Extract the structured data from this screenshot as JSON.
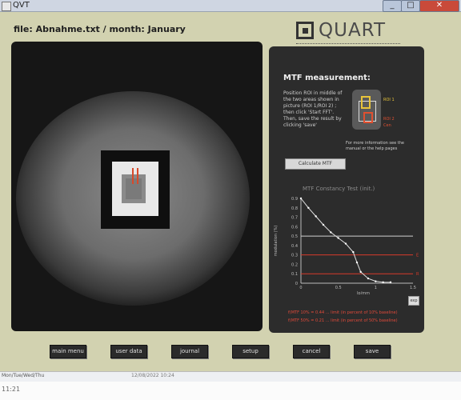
{
  "window": {
    "title": "QVT",
    "min": "_",
    "max": "□",
    "close": "✕"
  },
  "file_header": "file: Abnahme.txt  /  month: January",
  "logo": {
    "name": "QUART"
  },
  "mtf": {
    "heading": "MTF measurement:",
    "instructions": "Position ROI in middle of the two areas shown in picture (ROI 1/ROI 2) ; then click 'Start FFT'. Then, save the result by clicking 'save'",
    "roi1_label": "ROI 1",
    "roi2_label": "ROI 2",
    "roi_text": "Cen",
    "info": "For more information see the manual or the help pages",
    "calc_button": "Calculate MTF",
    "chart_title": "MTF Constancy Test (init.)",
    "export_label": "exp",
    "foot1": "f(MTF 10% = 0.44 ... limit (in percent of 10% baseline)",
    "foot2": "f(MTF 50% = 0.21 ... limit (in percent of 50% baseline)"
  },
  "chart_data": {
    "type": "line",
    "xlabel": "lp/mm",
    "ylabel": "modulation (%)",
    "x_ticks": [
      "0",
      "0.5",
      "1",
      "1.5"
    ],
    "y_ticks": [
      "0",
      "0.1",
      "0.2",
      "0.3",
      "0.4",
      "0.5",
      "0.6",
      "0.7",
      "0.8",
      "0.9"
    ],
    "xlim": [
      0,
      1.5
    ],
    "ylim": [
      0,
      0.9
    ],
    "series": [
      {
        "x": [
          0,
          0.1,
          0.2,
          0.3,
          0.4,
          0.5,
          0.6,
          0.7,
          0.75,
          0.8,
          0.9,
          1.0,
          1.1,
          1.2
        ],
        "y": [
          0.9,
          0.8,
          0.71,
          0.62,
          0.54,
          0.48,
          0.42,
          0.33,
          0.22,
          0.12,
          0.05,
          0.02,
          0.01,
          0.01
        ]
      }
    ],
    "reference_lines": [
      {
        "y": 0.5,
        "label": "",
        "color": "#cfcfcf"
      },
      {
        "y": 0.3,
        "label": "E",
        "color": "#d83a2a"
      },
      {
        "y": 0.1,
        "label": "R",
        "color": "#d83a2a"
      }
    ]
  },
  "buttons": [
    "main menu",
    "user data",
    "journal",
    "setup",
    "cancel",
    "save"
  ],
  "taskbar": {
    "item": "Mon/Tue/Wed/Thu",
    "item2": "12/08/2022  10:24"
  },
  "status": {
    "time": "11:21"
  }
}
